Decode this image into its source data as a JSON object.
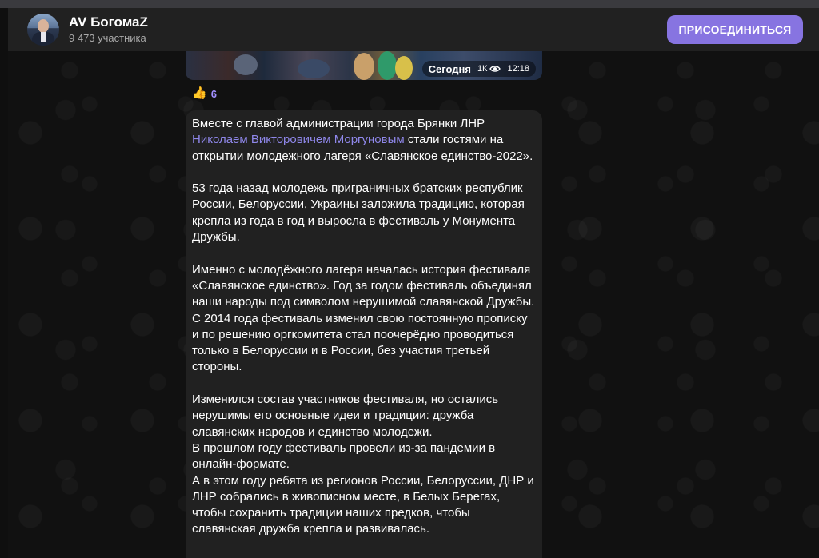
{
  "chat": {
    "title": "AV БогомаZ",
    "subtitle": "9 473 участника",
    "join_label": "ПРИСОЕДИНИТЬСЯ"
  },
  "photo_meta": {
    "date": "Сегодня",
    "views": "1К",
    "time": "12:18"
  },
  "reaction": {
    "emoji": "👍",
    "count": "6"
  },
  "message": {
    "p1_before": "Вместе с главой администрации города Брянки ЛНР ",
    "p1_mention": "Николаем Викторовичем Моргуновым",
    "p1_after": " стали гостями на открытии молодежного лагеря «Славянское единство-2022».",
    "p2": "53 года назад молодежь приграничных братских республик России, Белоруссии, Украины заложила традицию, которая крепла из года в год и выросла в фестиваль у Монумента Дружбы.",
    "p3": "Именно с молодёжного лагеря началась история фестиваля «Славянское единство». Год за годом фестиваль объединял наши народы под символом нерушимой славянской Дружбы. С 2014 года фестиваль изменил свою постоянную прописку и по решению оргкомитета стал поочерёдно проводиться только в Белоруссии и в России, без участия третьей стороны.",
    "p4_line1": "Изменился состав участников фестиваля, но остались нерушимы его основные идеи и традиции: дружба славянских народов и единство молодежи.",
    "p4_line2": "В прошлом году фестиваль провели из-за пандемии в онлайн-формате.",
    "p4_line3": "А в этом году ребята из регионов России, Белоруссии, ДНР и ЛНР собрались в живописном месте, в Белых Берегах, чтобы сохранить традиции наших предков, чтобы славянская дружба крепла и развивалась."
  },
  "colors": {
    "accent": "#8774e1",
    "mention": "#8f87ea",
    "bubble": "#212121",
    "header": "#212121"
  }
}
